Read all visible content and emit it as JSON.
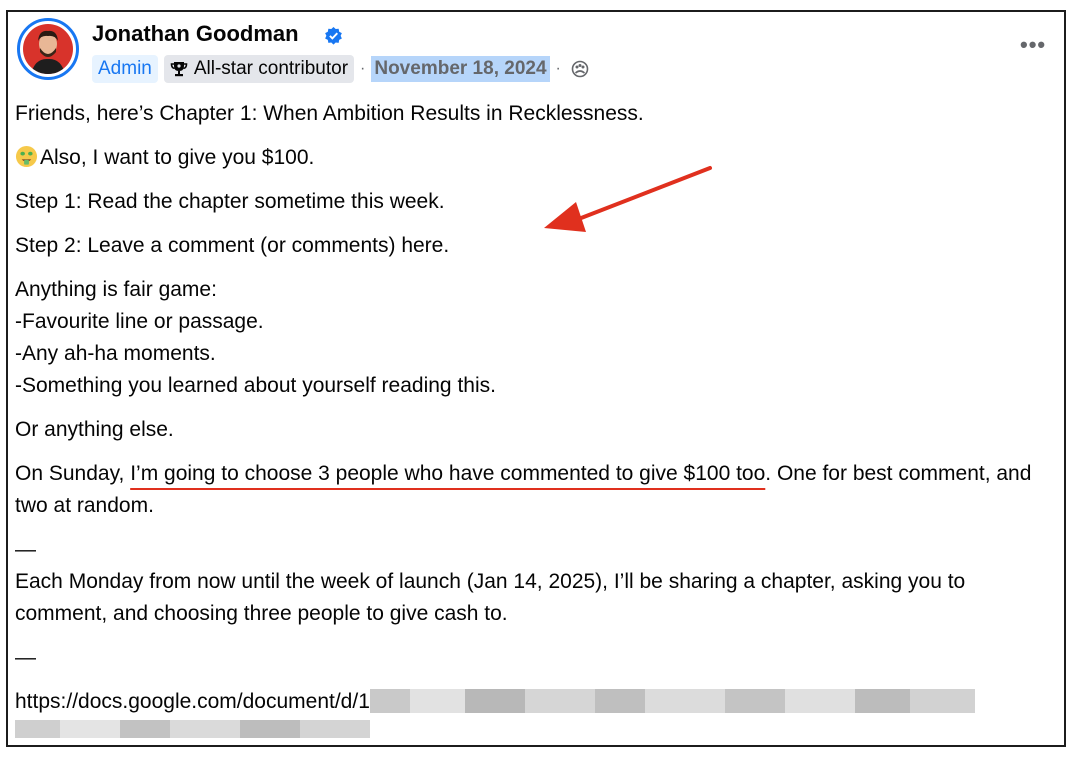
{
  "post": {
    "author": "Jonathan Goodman",
    "badges": {
      "admin": "Admin",
      "contributor": "All-star contributor"
    },
    "separator": "·",
    "date": "November 18, 2024",
    "lines": {
      "l1": "Friends, here’s Chapter 1: When Ambition Results in Recklessness.",
      "l2": "Also, I want to give you $100.",
      "l3": "Step 1: Read the chapter sometime this week.",
      "l4": "Step 2: Leave a comment (or comments) here.",
      "l5a": "Anything is fair game:",
      "l5b": "-Favourite line or passage.",
      "l5c": "-Any ah-ha moments.",
      "l5d": "-Something you learned about yourself reading this.",
      "l6": "Or anything else.",
      "l7_pre": "On Sunday, ",
      "l7_underlined": "I’m going to choose 3 people who have commented to give $100 too",
      "l7_post": ". One for best comment, and two at random.",
      "dash1": "—",
      "l8": "Each Monday from now until the week of launch (Jan 14, 2025), I’ll be sharing a chapter, asking you to comment, and choosing three people to give cash to.",
      "dash2": "—",
      "link_visible": "https://docs.google.com/document/d/1"
    }
  },
  "icons": {
    "verified": "verified-badge-icon",
    "trophy": "trophy-icon",
    "globe": "group-audience-icon",
    "more": "more-options-icon",
    "emoji": "money-mouth-face-emoji",
    "arrow": "red-annotation-arrow"
  },
  "colors": {
    "accent": "#1877f2",
    "annotation": "#e0301e",
    "date_highlight": "#b6d5fa"
  }
}
